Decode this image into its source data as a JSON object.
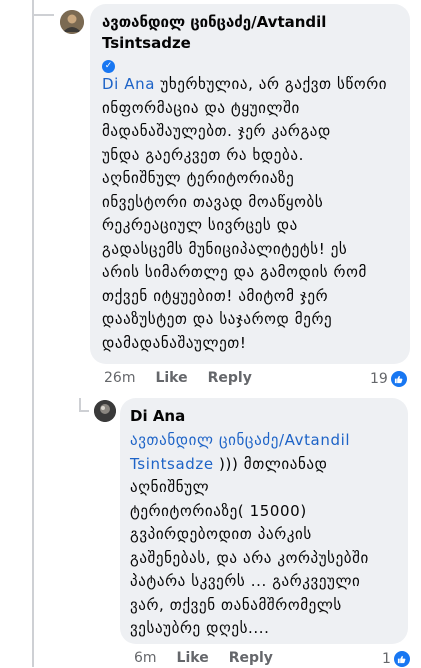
{
  "comments": [
    {
      "author": "ავთანდილ ცინცაძე/Avtandil Tsintsadze",
      "author_line1": "ავთანდილ ცინცაძე/Avtandil",
      "author_line2": "Tsintsadze",
      "mention": "Di Ana",
      "lines": [
        "უხერხულია, არ გაქვთ სწორი",
        "ინფორმაცია და ტყუილში",
        "მადანაშაულებთ. ჯერ კარგად",
        "უნდა გაერკვეთ რა ხდება.",
        "აღნიშნულ ტერიტორიაზე",
        "ინვესტორი თავად მოაწყობს",
        "რეკრეაციულ სივრცეს და",
        "გადასცემს მუნიციპალიტეტს! ეს",
        "არის სიმართლე და გამოდის რომ",
        "თქვენ იტყუებით! ამიტომ ჯერ",
        "დააზუსტეთ და საჯაროდ მერე",
        "დამადანაშაულეთ!"
      ],
      "time": "26m",
      "like_label": "Like",
      "reply_label": "Reply",
      "reaction_count": "19"
    },
    {
      "author": "Di Ana",
      "mention_line1": "ავთანდილ ცინცაძე/Avtandil",
      "mention_line2": "Tsintsadze",
      "first_line_rest": " ))) მთლიანად",
      "lines": [
        "აღნიშნულ",
        "ტერიტორიაზე( 15000)",
        "გვპირდებოდით პარკის",
        "გაშენებას, და არა კორპუსებში",
        "პატარა სკვერს ... გარკვეული",
        "ვარ, თქვენ თანამშრომელს",
        "ვესაუბრე დღეს...."
      ],
      "time": "6m",
      "like_label": "Like",
      "reply_label": "Reply",
      "reaction_count": "1"
    }
  ],
  "colors": {
    "mention": "#1d63c7",
    "bubble": "#eef0f3",
    "like": "#1877f2"
  },
  "icons": [
    "avatar",
    "verified-badge-icon",
    "like-reaction-icon"
  ]
}
